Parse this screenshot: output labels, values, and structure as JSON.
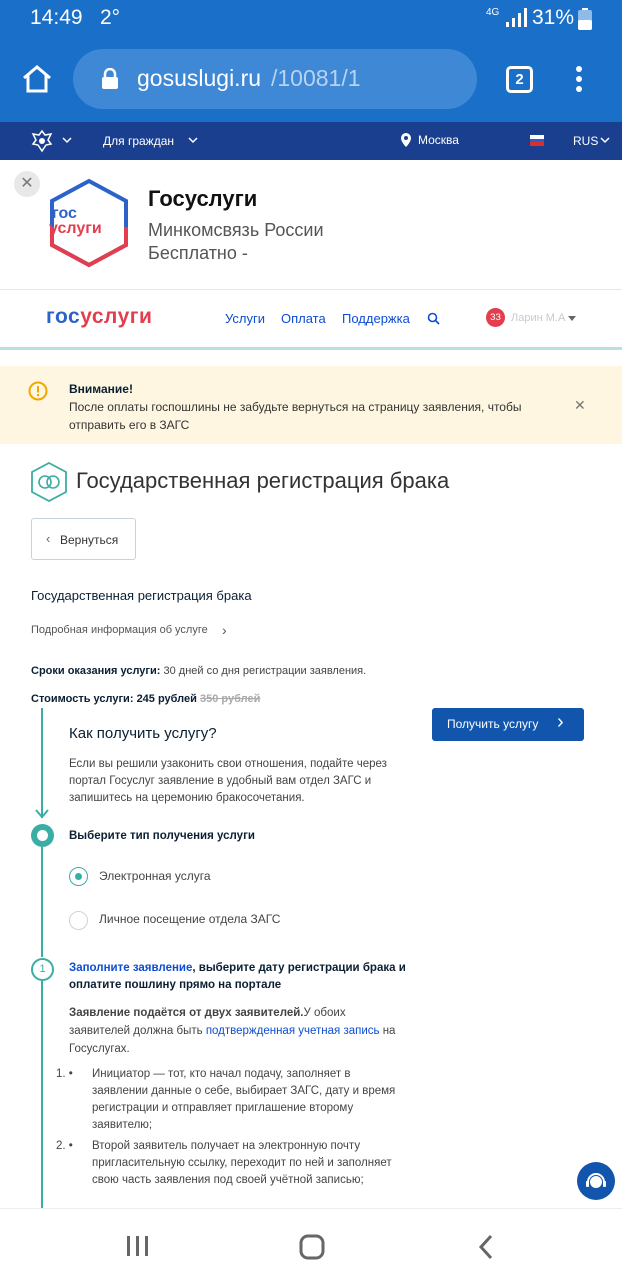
{
  "status": {
    "time": "14:49",
    "temp": "2°",
    "net": "4G",
    "battery": "31%"
  },
  "browser": {
    "url_host": "gosuslugi.ru",
    "url_path": "/10081/1",
    "tabs_count": "2"
  },
  "govbar": {
    "citizens": "Для граждан",
    "city": "Москва",
    "lang": "RUS"
  },
  "app_banner": {
    "title": "Госуслуги",
    "publisher": "Минкомсвязь России",
    "price": "Бесплатно -",
    "logo_line1": "гос",
    "logo_line2": "услуги"
  },
  "site_header": {
    "logo_a": "гос",
    "logo_b": "услуги",
    "nav": [
      "Услуги",
      "Оплата",
      "Поддержка"
    ],
    "user_badge": "ЗЗ",
    "user_name": "Ларин М.А"
  },
  "alert": {
    "title": "Внимание!",
    "text": "После оплаты госпошлины не забудьте вернуться на страницу заявления, чтобы отправить его в ЗАГС"
  },
  "page": {
    "title": "Государственная регистрация брака",
    "back": "Вернуться",
    "service_name": "Государственная регистрация брака",
    "details_link": "Подробная информация об услуге",
    "terms_label": "Сроки оказания услуги:",
    "terms_value": "30 дней со дня регистрации заявления.",
    "cost_label": "Стоимость услуги:",
    "cost_value": "245 рублей",
    "cost_old": "350 рублей",
    "get_service": "Получить услугу",
    "how_title": "Как получить услугу?",
    "how_text": "Если вы решили узаконить свои отношения, подайте через портал Госуслуг заявление в удобный вам отдел ЗАГС и запишитесь на церемонию бракосочетания.",
    "choose_type": "Выберите тип получения услуги",
    "options": [
      "Электронная услуга",
      "Личное посещение отдела ЗАГС"
    ],
    "step1_num": "1",
    "step1_link": "Заполните заявление",
    "step1_rest": ", выберите дату регистрации брака и оплатите пошлину прямо на портале",
    "para_bold": "Заявление подаётся от двух заявителей.",
    "para_a": "У обоих заявителей должна быть ",
    "para_link": "подтвержденная учетная запись",
    "para_b": " на Госуслугах.",
    "list": [
      {
        "num": "1. •",
        "text": "Инициатор — тот, кто начал подачу, заполняет в заявлении данные о себе, выбирает ЗАГС, дату и время регистрации и отправляет приглашение второму заявителю;"
      },
      {
        "num": "2. •",
        "text": "Второй заявитель получает на электронную почту пригласительную ссылку, переходит по ней и заполняет свою часть заявления под своей учётной записью;"
      }
    ]
  }
}
